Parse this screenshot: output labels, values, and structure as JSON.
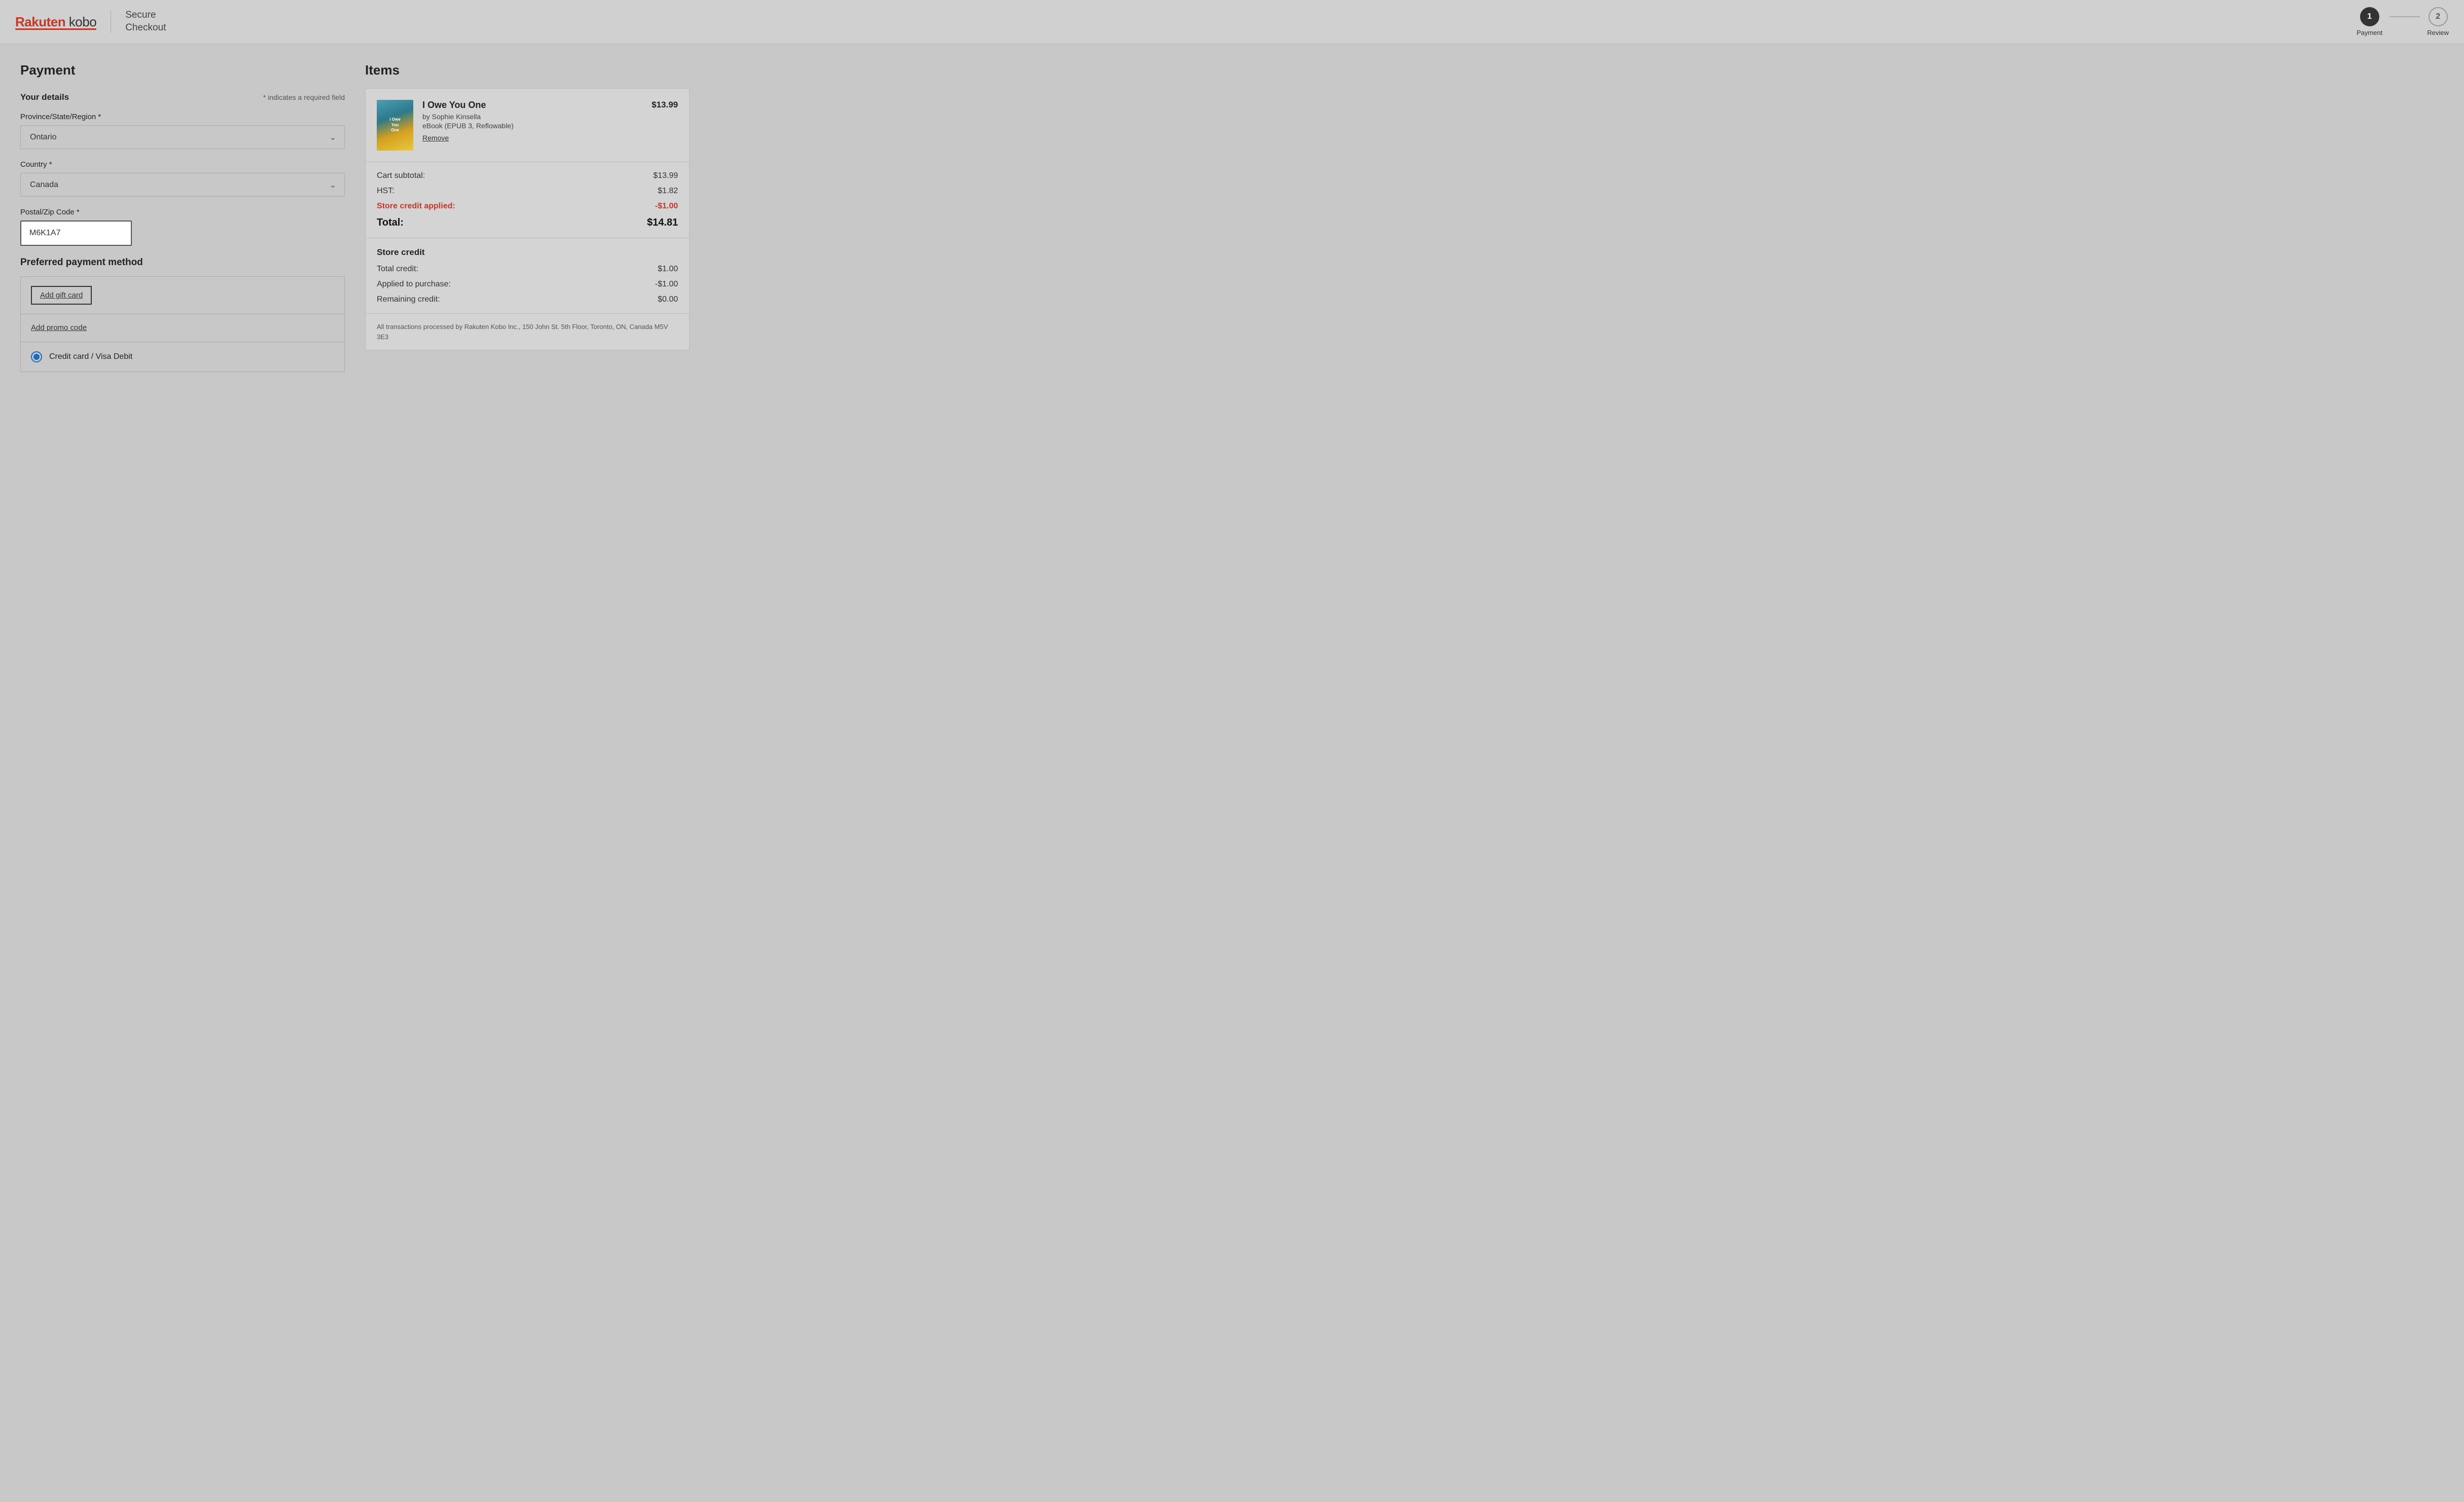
{
  "header": {
    "logo_main": "Rakuten",
    "logo_sub": "kobo",
    "secure_checkout_line1": "Secure",
    "secure_checkout_line2": "Checkout",
    "steps": [
      {
        "number": "1",
        "label": "Payment",
        "active": true
      },
      {
        "number": "2",
        "label": "Review",
        "active": false
      }
    ]
  },
  "payment": {
    "section_title": "Payment",
    "your_details_label": "Your details",
    "required_note": "* indicates a required field",
    "province_label": "Province/State/Region *",
    "province_value": "Ontario",
    "country_label": "Country *",
    "country_value": "Canada",
    "postal_label": "Postal/Zip Code *",
    "postal_value": "M6K1A7",
    "payment_method_title": "Preferred payment method",
    "add_gift_card_label": "Add gift card",
    "add_promo_label": "Add promo code",
    "credit_card_label": "Credit card / Visa Debit"
  },
  "items": {
    "section_title": "Items",
    "book": {
      "title": "I Owe You One",
      "author": "by Sophie Kinsella",
      "format": "eBook (EPUB 3, Reflowable)",
      "price": "$13.99",
      "remove_label": "Remove",
      "cover_text": "I Owe\nYou\nOne"
    },
    "cart_subtotal_label": "Cart subtotal:",
    "cart_subtotal_value": "$13.99",
    "hst_label": "HST:",
    "hst_value": "$1.82",
    "store_credit_applied_label": "Store credit applied:",
    "store_credit_applied_value": "-$1.00",
    "total_label": "Total:",
    "total_value": "$14.81",
    "store_credit_section_title": "Store credit",
    "total_credit_label": "Total credit:",
    "total_credit_value": "$1.00",
    "applied_label": "Applied to purchase:",
    "applied_value": "-$1.00",
    "remaining_label": "Remaining credit:",
    "remaining_value": "$0.00",
    "footer_note": "All transactions processed by Rakuten Kobo Inc., 150 John St. 5th Floor, Toronto, ON, Canada M5V 3E3"
  },
  "colors": {
    "accent_red": "#c0392b",
    "step_active_bg": "#333333",
    "store_credit_red": "#c0392b"
  }
}
